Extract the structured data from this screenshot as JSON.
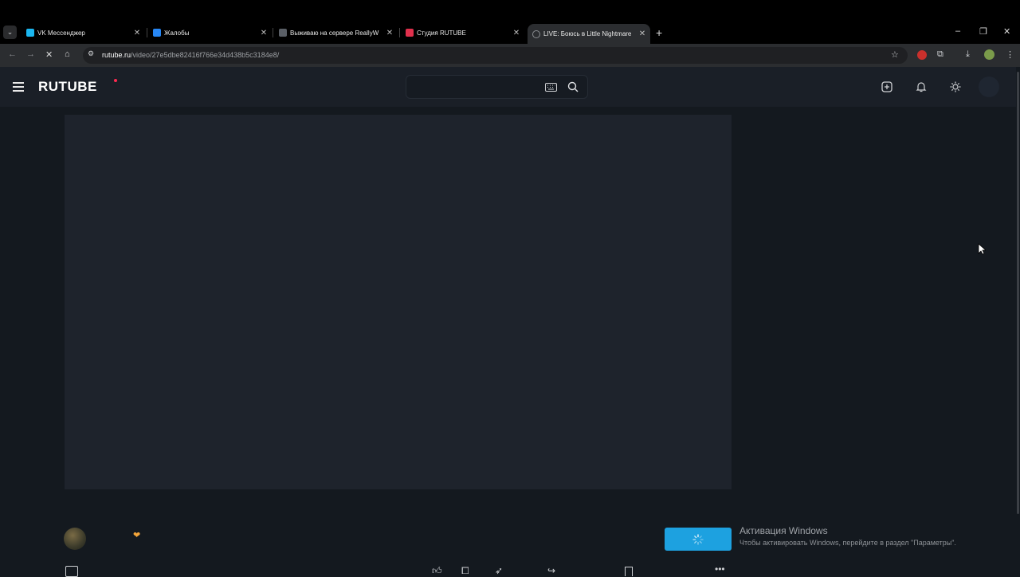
{
  "browser": {
    "tabs": [
      {
        "title": "VK Мессенджер",
        "favicon_color": "#1bb7f0"
      },
      {
        "title": "Жалобы",
        "favicon_color": "#2787f5"
      },
      {
        "title": "Выживаю на сервере ReallyW",
        "favicon_color": "#5a5f66"
      },
      {
        "title": "Студия RUTUBE",
        "favicon_color": "#e0304c"
      },
      {
        "title": "LIVE: Боюсь в Little Nightmare",
        "favicon_color": "#8a8d91"
      }
    ],
    "address": {
      "host": "rutube.ru",
      "path": "/video/27e5dbe82416f766e34d438b5c3184e8/"
    }
  },
  "site": {
    "logo_text": "RUTUBE",
    "accent_color": "#ff2a50"
  },
  "channel": {
    "badge_icon": "heart-icon"
  },
  "watermark": {
    "title": "Активация Windows",
    "text": "Чтобы активировать Windows, перейдите в раздел \"Параметры\"."
  }
}
